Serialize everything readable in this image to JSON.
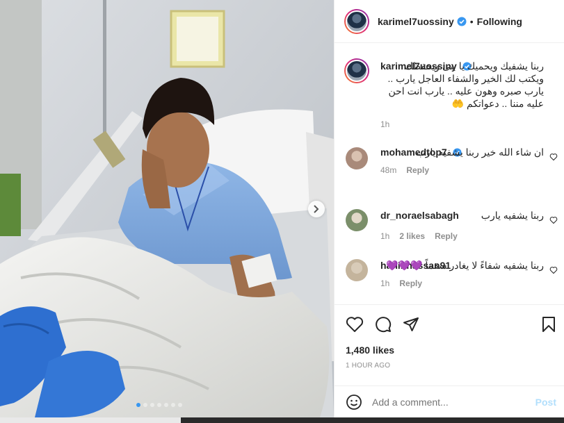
{
  "post": {
    "author": "karimel7uossiny",
    "follow_label": "Following",
    "separator": "•"
  },
  "caption": {
    "author": "karimel7uossiny",
    "text": "ربنا يشفيك ويحميك يا بنى ويحفظك ويكتب لك الخير والشفاء العاجل يارب .. يارب صبره وهون عليه .. يارب انت احن عليه مننا .. دعواتكم 🤲",
    "time": "1h"
  },
  "comments": [
    {
      "author": "mohamedtop7",
      "verified": true,
      "text": "ان شاء الله خير ربنا يشفيه يارب",
      "time": "48m",
      "likes": "",
      "reply_label": "Reply"
    },
    {
      "author": "dr_noraelsabagh",
      "verified": false,
      "text": "ربنا يشفيه يارب",
      "time": "1h",
      "likes": "2 likes",
      "reply_label": "Reply"
    },
    {
      "author": "haninhassan91",
      "verified": false,
      "text": "ربنا يشفيه شفاءً لا يغادر سقماً 💜💜💜",
      "time": "1h",
      "likes": "",
      "reply_label": "Reply"
    }
  ],
  "stats": {
    "likes": "1,480 likes",
    "posted": "1 HOUR AGO"
  },
  "composer": {
    "placeholder": "Add a comment...",
    "post_label": "Post"
  },
  "icons": {
    "verified": "verified-badge-icon",
    "like": "heart-icon",
    "comment": "comment-bubble-icon",
    "share": "paper-plane-icon",
    "save": "bookmark-icon",
    "emoji": "smiley-icon",
    "next": "chevron-right-icon"
  },
  "colors": {
    "accent": "#3897f0",
    "post_disabled": "#b2dffc",
    "muted": "#8e8e8e",
    "text": "#262626"
  },
  "carousel": {
    "slides": 7,
    "active_index": 0
  }
}
